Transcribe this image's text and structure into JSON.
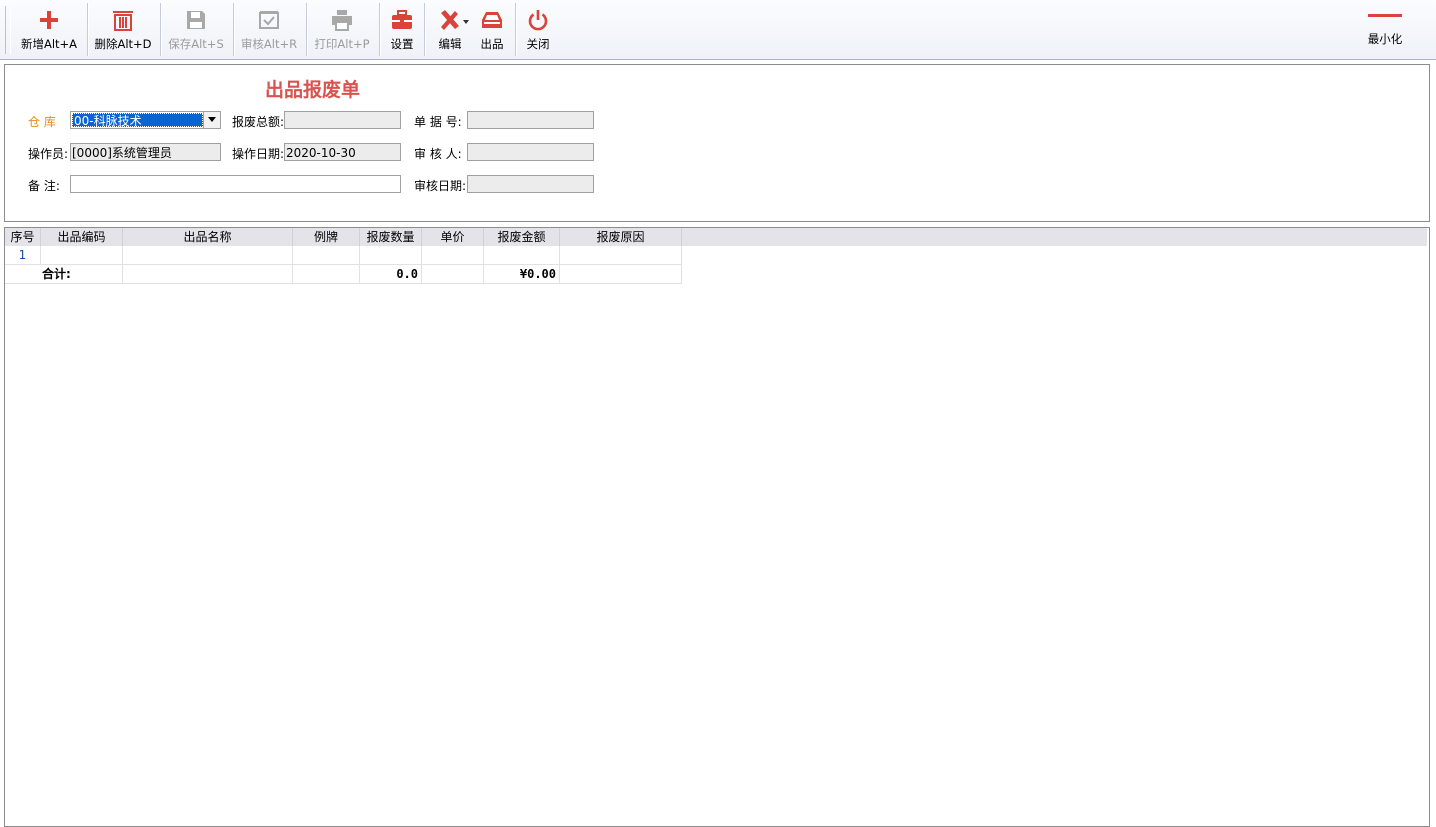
{
  "toolbar": {
    "buttons": [
      {
        "label": "新增Alt+A",
        "icon": "plus-icon",
        "enabled": true
      },
      {
        "label": "删除Alt+D",
        "icon": "trash-icon",
        "enabled": true
      },
      {
        "label": "保存Alt+S",
        "icon": "save-icon",
        "enabled": false
      },
      {
        "label": "审核Alt+R",
        "icon": "approve-icon",
        "enabled": false
      },
      {
        "label": "打印Alt+P",
        "icon": "print-icon",
        "enabled": false
      },
      {
        "label": "设置",
        "icon": "toolbox-icon",
        "enabled": true
      },
      {
        "label": "编辑",
        "icon": "edit-icon",
        "enabled": true
      },
      {
        "label": "出品",
        "icon": "product-icon",
        "enabled": true
      },
      {
        "label": "关闭",
        "icon": "power-icon",
        "enabled": true
      }
    ],
    "minimize_label": "最小化"
  },
  "form": {
    "title": "出品报废单",
    "warehouse_label": "仓 库",
    "warehouse_value": "00-科脉技术",
    "total_label": "报废总额:",
    "total_value": "",
    "docno_label": "单 据 号:",
    "docno_value": "",
    "operator_label": "操作员:",
    "operator_value": "[0000]系统管理员",
    "opdate_label": "操作日期:",
    "opdate_value": "2020-10-30",
    "reviewer_label": "审 核 人:",
    "reviewer_value": "",
    "remark_label": "备 注:",
    "remark_value": "",
    "reviewdate_label": "审核日期:",
    "reviewdate_value": ""
  },
  "grid": {
    "columns": [
      "序号",
      "出品编码",
      "出品名称",
      "例牌",
      "报废数量",
      "单价",
      "报废金额",
      "报废原因"
    ],
    "rows": [
      {
        "seq": "1",
        "code": "",
        "name": "",
        "spec": "",
        "qty": "",
        "price": "",
        "amount": "",
        "reason": ""
      }
    ],
    "total": {
      "label": "合计:",
      "qty": "0.0",
      "amount": "¥0.00"
    }
  },
  "colors": {
    "title": "#d9534f",
    "accent_icon": "#d9433a",
    "label_orange": "#e6891a",
    "selection": "#0a64d2"
  }
}
